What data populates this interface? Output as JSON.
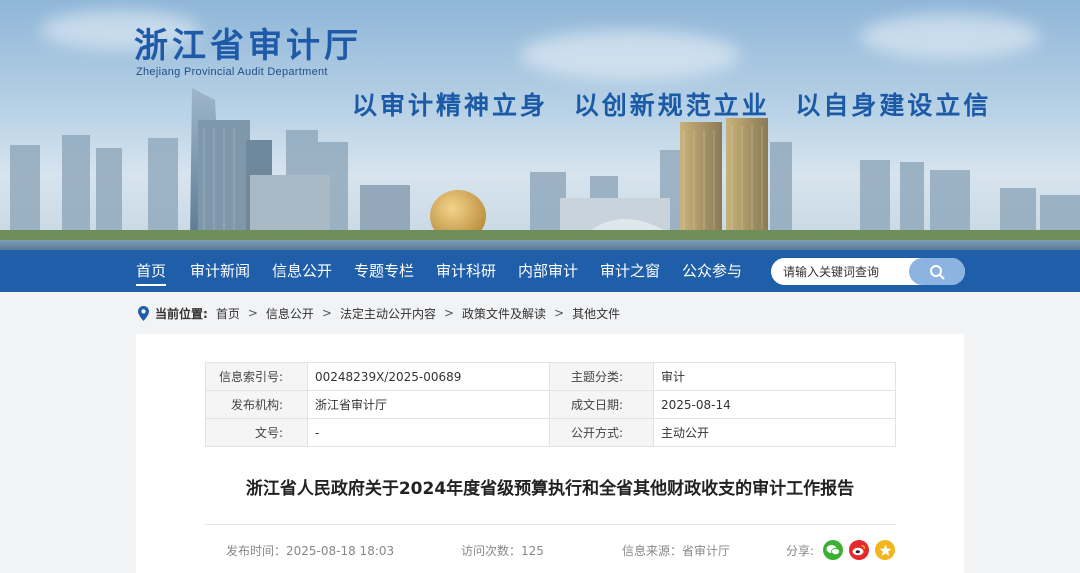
{
  "site": {
    "name_cn": "浙江省审计厅",
    "name_en": "Zhejiang Provincial Audit Department",
    "slogan": "以审计精神立身 以创新规范立业 以自身建设立信"
  },
  "nav": {
    "items": [
      "首页",
      "审计新闻",
      "信息公开",
      "专题专栏",
      "审计科研",
      "内部审计",
      "审计之窗",
      "公众参与"
    ],
    "active_index": 0,
    "search_placeholder": "请输入关键词查询"
  },
  "breadcrumb": {
    "label": "当前位置:",
    "items": [
      "首页",
      "信息公开",
      "法定主动公开内容",
      "政策文件及解读",
      "其他文件"
    ],
    "separator": ">"
  },
  "meta_table": {
    "rows": [
      {
        "k1": "信息索引号:",
        "v1": "00248239X/2025-00689",
        "k2": "主题分类:",
        "v2": "审计"
      },
      {
        "k1": "发布机构:",
        "v1": "浙江省审计厅",
        "k2": "成文日期:",
        "v2": "2025-08-14"
      },
      {
        "k1": "文号:",
        "v1": "-",
        "k2": "公开方式:",
        "v2": "主动公开"
      }
    ]
  },
  "article": {
    "title": "浙江省人民政府关于2024年度省级预算执行和全省其他财政收支的审计工作报告",
    "publish_time": "发布时间：2025-08-18 18:03",
    "visits": "访问次数：125",
    "source": "信息来源：省审计厅",
    "share_label": "分享:"
  },
  "share": [
    {
      "icon": "wechat-icon",
      "color": "#3cb034"
    },
    {
      "icon": "weibo-icon",
      "color": "#e6282a"
    },
    {
      "icon": "qzone-icon",
      "color": "#f2b51c"
    }
  ],
  "colors": {
    "nav_bg": "#1f5ea8",
    "brand": "#1e5aa8"
  }
}
